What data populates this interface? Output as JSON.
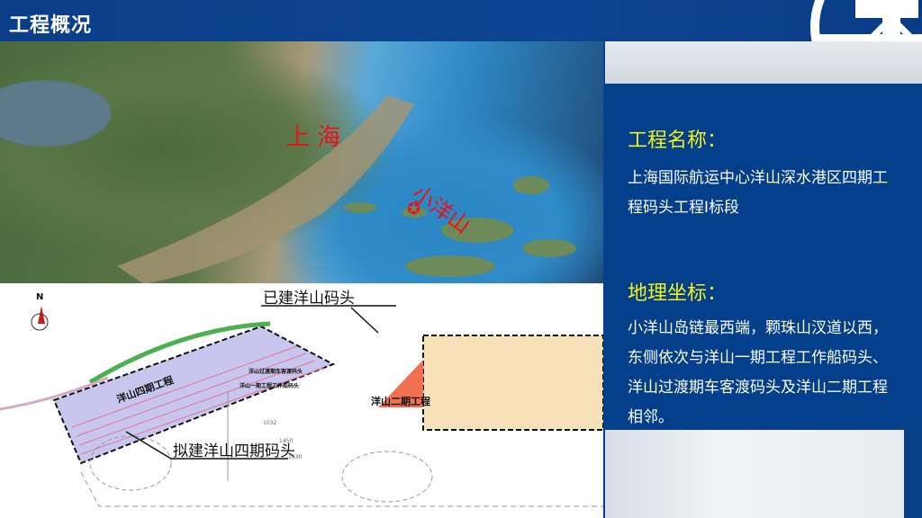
{
  "header": {
    "title": "工程概况"
  },
  "map": {
    "label_shanghai": "上 海",
    "label_xiaoyangshan": "小洋山"
  },
  "plan": {
    "label_existing": "已建洋山码头",
    "label_proposed": "拟建洋山四期码头",
    "label_phase4": "洋山四期工程",
    "label_phase2": "洋山二期工程",
    "label_ferry": "洋山过渡期车客渡码头",
    "label_workboat": "洋山一期工程工作船码头",
    "north": "N",
    "dim1": "1032",
    "dim2": "1450",
    "dim3": "1630"
  },
  "panel": {
    "name_heading": "工程名称：",
    "name_text": "上海国际航运中心洋山深水港区四期工程码头工程Ⅰ标段",
    "geo_heading": "地理坐标：",
    "geo_text": "小洋山岛链最西端，颗珠山汊道以西，东侧依次与洋山一期工程工作船码头、洋山过渡期车客渡码头及洋山二期工程相邻。"
  }
}
